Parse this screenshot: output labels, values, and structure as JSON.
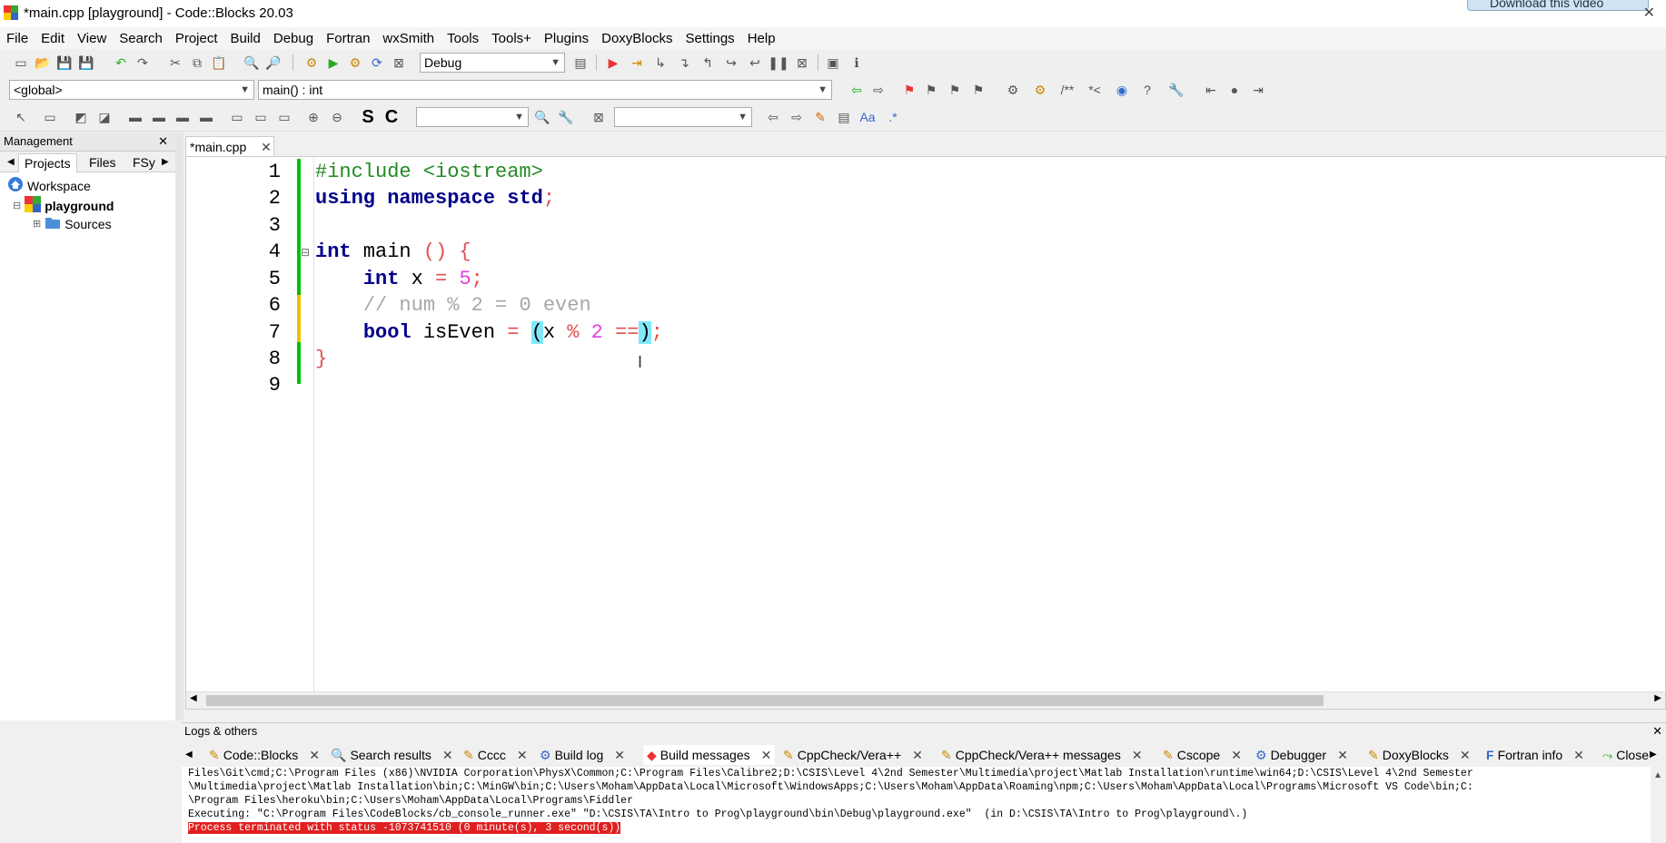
{
  "window": {
    "title": "*main.cpp [playground] - Code::Blocks 20.03",
    "download_label": "Download this video"
  },
  "menu": [
    "File",
    "Edit",
    "View",
    "Search",
    "Project",
    "Build",
    "Debug",
    "Fortran",
    "wxSmith",
    "Tools",
    "Tools+",
    "Plugins",
    "DoxyBlocks",
    "Settings",
    "Help"
  ],
  "toolbar": {
    "build_target": "Debug"
  },
  "codecompletion": {
    "scope": "<global>",
    "function": "main() : int"
  },
  "management": {
    "title": "Management",
    "tabs": [
      "Projects",
      "Files",
      "FSy"
    ],
    "tree": {
      "workspace": "Workspace",
      "project": "playground",
      "folder": "Sources"
    }
  },
  "editor": {
    "tab_label": "*main.cpp",
    "line_numbers": [
      "1",
      "2",
      "3",
      "4",
      "5",
      "6",
      "7",
      "8",
      "9"
    ]
  },
  "code": {
    "l1": "#include <iostream>",
    "l2_kw1": "using",
    "l2_kw2": "namespace",
    "l2_kw3": "std",
    "l2_semi": ";",
    "l4_kw": "int",
    "l4_name": " main ",
    "l4_paren": "()",
    "l4_brace": " {",
    "l5_kw": "int",
    "l5_var": " x ",
    "l5_eq": "=",
    "l5_num": "5",
    "l5_semi": ";",
    "l6": "// num % 2 = 0 even",
    "l7_kw": "bool",
    "l7_var": " isEven ",
    "l7_eq": "=",
    "l7_open": "(",
    "l7_x": "x ",
    "l7_mod": "%",
    "l7_two": "2",
    "l7_eqeq": "==",
    "l7_close": ")",
    "l7_semi": ";",
    "l8": "}"
  },
  "logs": {
    "title": "Logs & others",
    "tabs": [
      "Code::Blocks",
      "Search results",
      "Cccc",
      "Build log",
      "Build messages",
      "CppCheck/Vera++",
      "CppCheck/Vera++ messages",
      "Cscope",
      "Debugger",
      "DoxyBlocks",
      "Fortran info",
      "Close"
    ],
    "lines": [
      "Files\\Git\\cmd;C:\\Program Files (x86)\\NVIDIA Corporation\\PhysX\\Common;C:\\Program Files\\Calibre2;D:\\CSIS\\Level 4\\2nd Semester\\Multimedia\\project\\Matlab Installation\\runtime\\win64;D:\\CSIS\\Level 4\\2nd Semester",
      "\\Multimedia\\project\\Matlab Installation\\bin;C:\\MinGW\\bin;C:\\Users\\Moham\\AppData\\Local\\Microsoft\\WindowsApps;C:\\Users\\Moham\\AppData\\Roaming\\npm;C:\\Users\\Moham\\AppData\\Local\\Programs\\Microsoft VS Code\\bin;C:",
      "\\Program Files\\heroku\\bin;C:\\Users\\Moham\\AppData\\Local\\Programs\\Fiddler",
      "Executing: \"C:\\Program Files\\CodeBlocks/cb_console_runner.exe\" \"D:\\CSIS\\TA\\Intro to Prog\\playground\\bin\\Debug\\playground.exe\"  (in D:\\CSIS\\TA\\Intro to Prog\\playground\\.)"
    ],
    "error_line": "Process terminated with status -1073741510 (0 minute(s), 3 second(s))"
  }
}
